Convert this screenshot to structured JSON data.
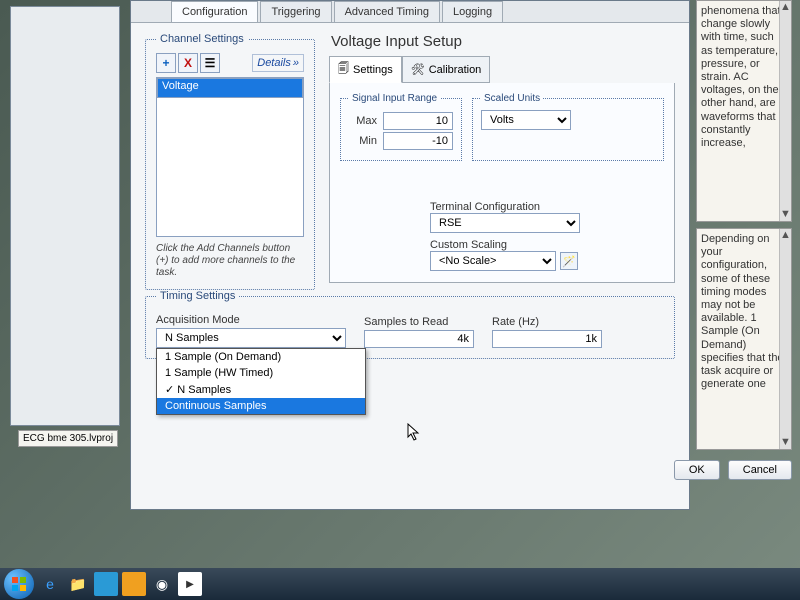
{
  "project_file": "ECG bme 305.lvproj",
  "tabs": {
    "configuration": "Configuration",
    "triggering": "Triggering",
    "advanced": "Advanced Timing",
    "logging": "Logging"
  },
  "channel": {
    "group": "Channel Settings",
    "details": "Details",
    "item": "Voltage",
    "hint": "Click the Add Channels button (+) to add more channels to the task.",
    "add": "+",
    "del": "X"
  },
  "voltage": {
    "title": "Voltage Input Setup",
    "tab_settings": "Settings",
    "tab_cal": "Calibration",
    "sig_group": "Signal Input Range",
    "max_lbl": "Max",
    "max_val": "10",
    "min_lbl": "Min",
    "min_val": "-10",
    "scaled_group": "Scaled Units",
    "scaled_val": "Volts",
    "term_lbl": "Terminal Configuration",
    "term_val": "RSE",
    "scale_lbl": "Custom Scaling",
    "scale_val": "<No Scale>"
  },
  "timing": {
    "group": "Timing Settings",
    "acq_lbl": "Acquisition Mode",
    "acq_val": "N Samples",
    "options": [
      "1 Sample (On Demand)",
      "1 Sample (HW Timed)",
      "N Samples",
      "Continuous Samples"
    ],
    "checked_idx": 2,
    "hover_idx": 3,
    "samples_lbl": "Samples to Read",
    "samples_val": "4k",
    "rate_lbl": "Rate (Hz)",
    "rate_val": "1k"
  },
  "help": {
    "text1": "phenomena that change slowly with time, such as temperature, pressure, or strain.\n\nAC voltages, on the other hand, are waveforms that constantly increase,",
    "text2": "Depending on your configuration, some of these timing modes may not be available.\n\n1 Sample (On Demand) specifies that the task acquire or generate one"
  },
  "buttons": {
    "ok": "OK",
    "cancel": "Cancel"
  }
}
